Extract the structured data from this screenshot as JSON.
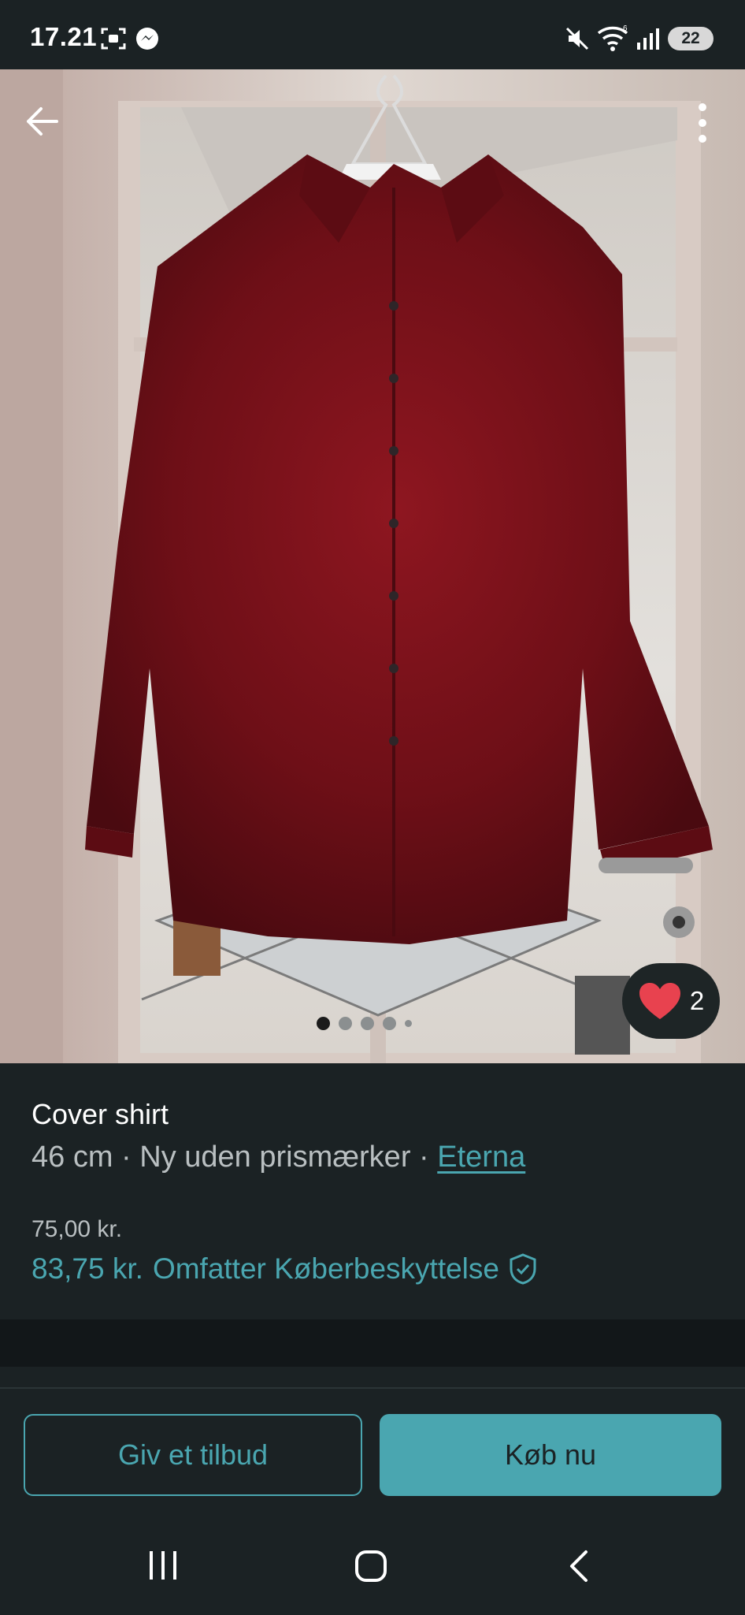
{
  "status_bar": {
    "time": "17.21",
    "battery_level": "22",
    "icons": [
      "screenshot-icon",
      "messenger-icon",
      "mute-icon",
      "wifi-icon",
      "signal-icon",
      "battery-icon"
    ]
  },
  "gallery": {
    "image_description_icon": "product-photo",
    "photo_count": 5,
    "active_index": 0,
    "favorite_count": "2"
  },
  "item": {
    "title": "Cover shirt",
    "size": "46 cm",
    "separator": "·",
    "condition": "Ny uden prismærker",
    "brand": "Eterna",
    "price": "75,00 kr.",
    "total_price": "83,75 kr.",
    "protection_label": "Omfatter Køberbeskyttelse"
  },
  "actions": {
    "offer_label": "Giv et tilbud",
    "buy_label": "Køb nu"
  },
  "colors": {
    "accent": "#4aa6b0",
    "background": "#1b2224",
    "favorite_heart": "#e8424f"
  }
}
